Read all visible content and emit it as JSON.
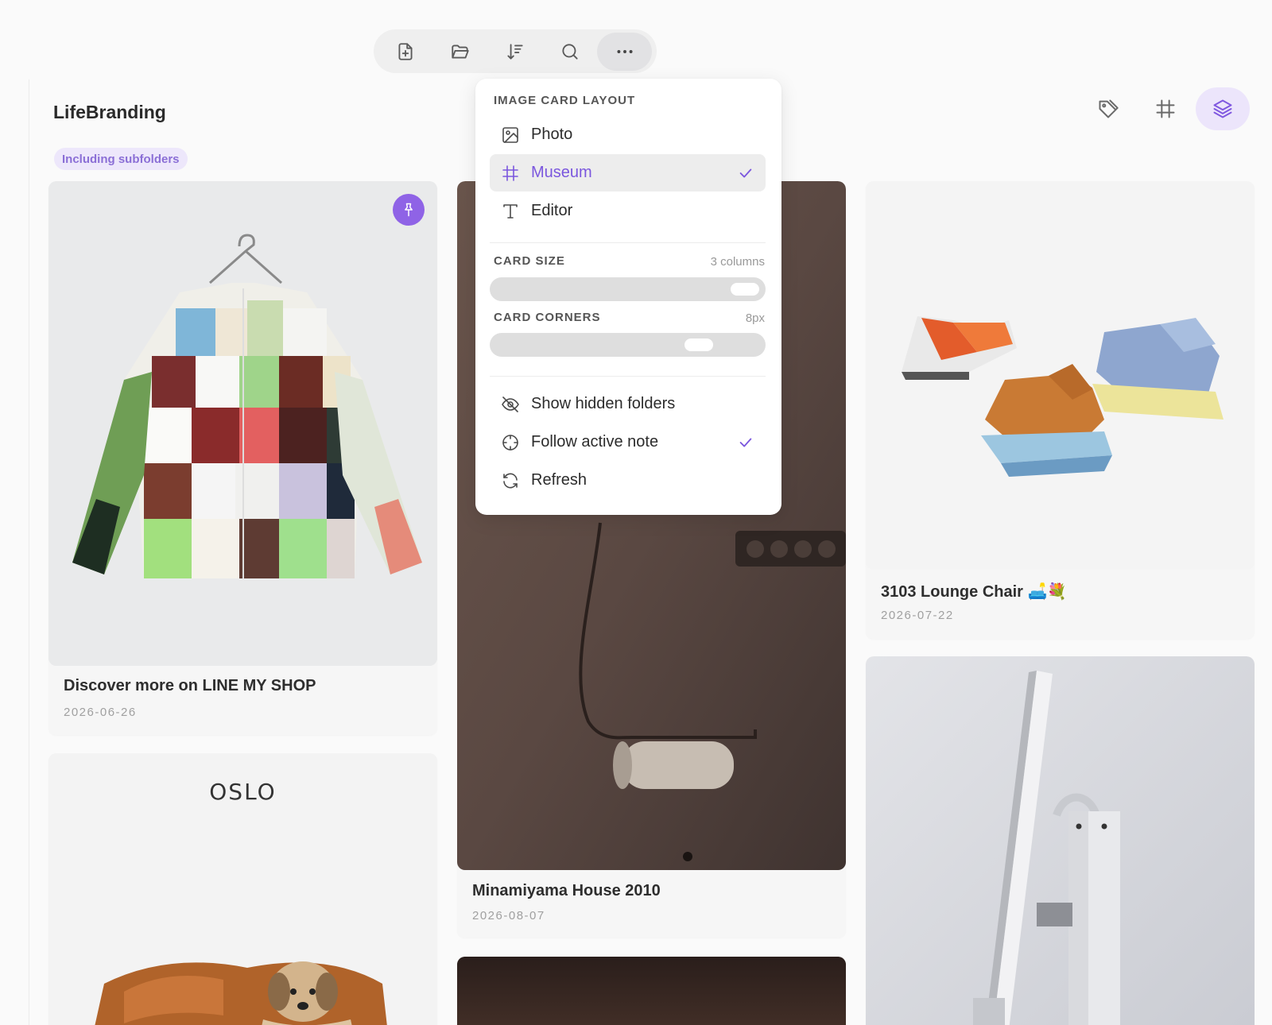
{
  "app": {
    "title": "LifeBranding",
    "scope_badge": "Including subfolders"
  },
  "toolbar": {
    "buttons": [
      {
        "icon": "new-note-icon"
      },
      {
        "icon": "folder-open-icon"
      },
      {
        "icon": "sort-icon"
      },
      {
        "icon": "search-icon"
      },
      {
        "icon": "more-icon"
      }
    ]
  },
  "header_icons": [
    "tag-icon",
    "grid-icon",
    "layers-icon"
  ],
  "menu": {
    "image_card_layout": {
      "heading": "IMAGE CARD LAYOUT",
      "options": [
        {
          "label": "Photo",
          "icon": "image-icon",
          "selected": false
        },
        {
          "label": "Museum",
          "icon": "grid-icon",
          "selected": true
        },
        {
          "label": "Editor",
          "icon": "text-icon",
          "selected": false
        }
      ]
    },
    "card_size": {
      "heading": "CARD SIZE",
      "value": "3 columns",
      "level": 0.95
    },
    "card_corners": {
      "heading": "CARD CORNERS",
      "value": "8px",
      "level": 0.75
    },
    "actions": [
      {
        "label": "Show hidden folders",
        "icon": "eye-off-icon",
        "checked": false
      },
      {
        "label": "Follow active note",
        "icon": "crosshair-icon",
        "checked": true
      },
      {
        "label": "Refresh",
        "icon": "refresh-icon",
        "checked": false
      }
    ]
  },
  "cards": [
    {
      "title": "Discover more on LINE MY SHOP",
      "date": "2026-06-26",
      "pinned": true
    },
    {
      "title": "Minamiyama House 2010",
      "date": "2026-08-07",
      "pinned": false
    },
    {
      "title": "3103 Lounge Chair 🛋️💐",
      "date": "2026-07-22",
      "pinned": false
    },
    {
      "image_text": "OSLO"
    }
  ],
  "colors": {
    "accent": "#8058e0",
    "badge_bg": "#ede7fb",
    "background": "#fafafa"
  }
}
